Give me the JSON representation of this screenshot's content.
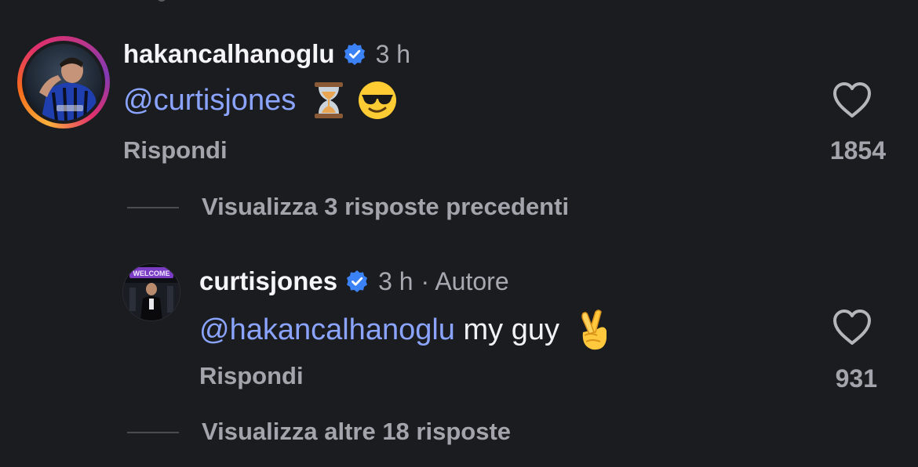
{
  "colors": {
    "background": "#1b1c20",
    "mention": "#8aa4ff",
    "verified": "#3b82f6",
    "secondary_text": "#a4a5ac"
  },
  "comments": [
    {
      "username": "hakancalhanoglu",
      "verified": true,
      "time": "3 h",
      "mention": "@curtisjones",
      "text": "",
      "emojis": [
        "hourglass-emoji",
        "sunglasses-emoji"
      ],
      "reply_label": "Rispondi",
      "like_count": "1854",
      "has_story_ring": true
    },
    {
      "username": "curtisjones",
      "verified": true,
      "time": "3 h",
      "author_tag": "· Autore",
      "mention": "@hakancalhanoglu",
      "text": " my guy",
      "emojis": [
        "crossed-fingers-emoji"
      ],
      "reply_label": "Rispondi",
      "like_count": "931",
      "has_story_ring": false
    }
  ],
  "view_previous_label": "Visualizza 3 risposte precedenti",
  "view_more_label": "Visualizza altre 18 risposte"
}
